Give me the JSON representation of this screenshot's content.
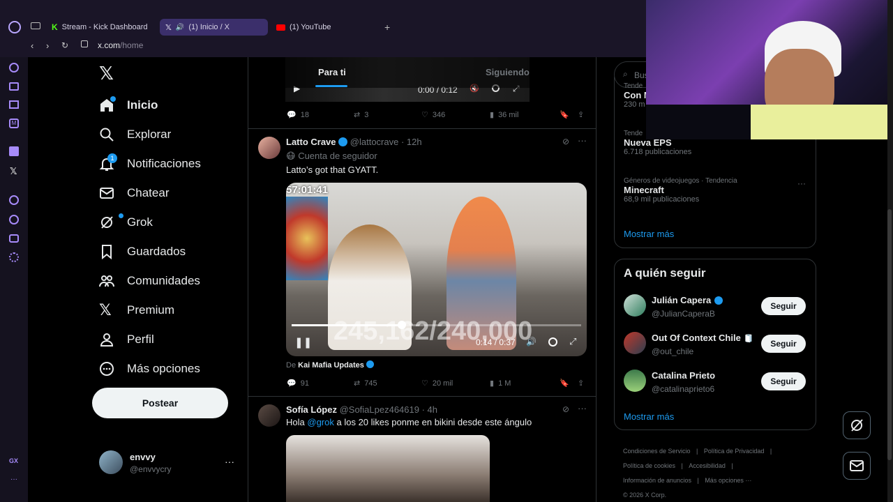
{
  "browser": {
    "tabs": [
      {
        "label": "Stream - Kick Dashboard"
      },
      {
        "label": "(1) Inicio / X"
      },
      {
        "label": "(1) YouTube"
      }
    ],
    "url_domain": "x.com",
    "url_path": "/home",
    "corner_badge": "GX"
  },
  "nav": {
    "items": [
      {
        "label": "Inicio"
      },
      {
        "label": "Explorar"
      },
      {
        "label": "Notificaciones"
      },
      {
        "label": "Chatear"
      },
      {
        "label": "Grok"
      },
      {
        "label": "Guardados"
      },
      {
        "label": "Comunidades"
      },
      {
        "label": "Premium"
      },
      {
        "label": "Perfil"
      },
      {
        "label": "Más opciones"
      }
    ],
    "notif_count": "1",
    "post_label": "Postear",
    "account": {
      "name": "envvy",
      "handle": "@envvycry"
    }
  },
  "feed": {
    "tabs": [
      "Para ti",
      "Siguiendo"
    ],
    "prev_tweet": {
      "video_time": "0:00 / 0:12",
      "replies": "18",
      "reposts": "3",
      "likes": "346",
      "views": "36 mil"
    },
    "tweet1": {
      "name": "Latto Crave",
      "handle": "@lattocrave",
      "time": "· 12h",
      "context": "Cuenta de seguidor",
      "text": "Latto’s got that GYATT.",
      "video_overlay_time": "57:01:41",
      "video_counter": "245,162/240,000",
      "video_time": "0:14 / 0:37",
      "from_prefix": "De",
      "from_name": "Kai Mafia Updates",
      "replies": "91",
      "reposts": "745",
      "likes": "20 mil",
      "views": "1 M"
    },
    "tweet2": {
      "name": "Sofía López",
      "handle": "@SofiaLpez464619",
      "time": "· 4h",
      "text_pre": "Hola",
      "mention": "@grok",
      "text_post": "a los 20 likes ponme en bikini desde este ángulo"
    }
  },
  "right": {
    "search_placeholder": "Bus",
    "trends": [
      {
        "context": "Tende",
        "title": "Con M",
        "count": "230 m"
      },
      {
        "context": "Tende",
        "title": "Nueva EPS",
        "count": "6.718 publicaciones"
      },
      {
        "context": "Géneros de videojuegos · Tendencia",
        "title": "Minecraft",
        "count": "68,9 mil publicaciones"
      }
    ],
    "show_more": "Mostrar más",
    "who_to_follow_title": "A quién seguir",
    "follow": [
      {
        "name": "Julián Capera",
        "handle": "@JulianCaperaB",
        "button": "Seguir"
      },
      {
        "name": "Out Of Context Chile",
        "handle": "@out_chile",
        "button": "Seguir"
      },
      {
        "name": "Catalina Prieto",
        "handle": "@catalinaprieto6",
        "button": "Seguir"
      }
    ],
    "follow_more": "Mostrar más",
    "footer": [
      "Condiciones de Servicio",
      "|",
      "Política de Privacidad",
      "|",
      "Política de cookies",
      "|",
      "Accesibilidad",
      "|",
      "Información de anuncios",
      "|",
      "Más opciones ···",
      "© 2026 X Corp."
    ]
  },
  "colors": {
    "accent": "#1d9bf0",
    "tab_active": "#3b2f6b",
    "opera_purple": "#a78bfa"
  }
}
